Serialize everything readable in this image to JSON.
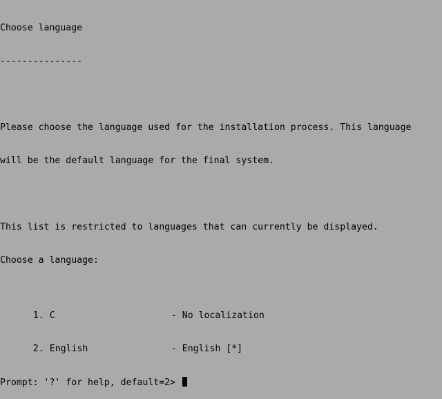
{
  "screen": {
    "heading": "Choose language",
    "underline": "---------------",
    "intro_line1": "Please choose the language used for the installation process. This language",
    "intro_line2": "will be the default language for the final system.",
    "restriction_note": "This list is restricted to languages that can currently be displayed.",
    "choose_label": "Choose a language:",
    "options": [
      {
        "number": "1.",
        "name": "C",
        "dash": "-",
        "description": "No localization"
      },
      {
        "number": "2.",
        "name": "English",
        "dash": "-",
        "description": "English [*]"
      }
    ],
    "prompt": "Prompt: '?' for help, default=2> "
  },
  "colors": {
    "background": "#aaaaaa",
    "text": "#000000"
  }
}
